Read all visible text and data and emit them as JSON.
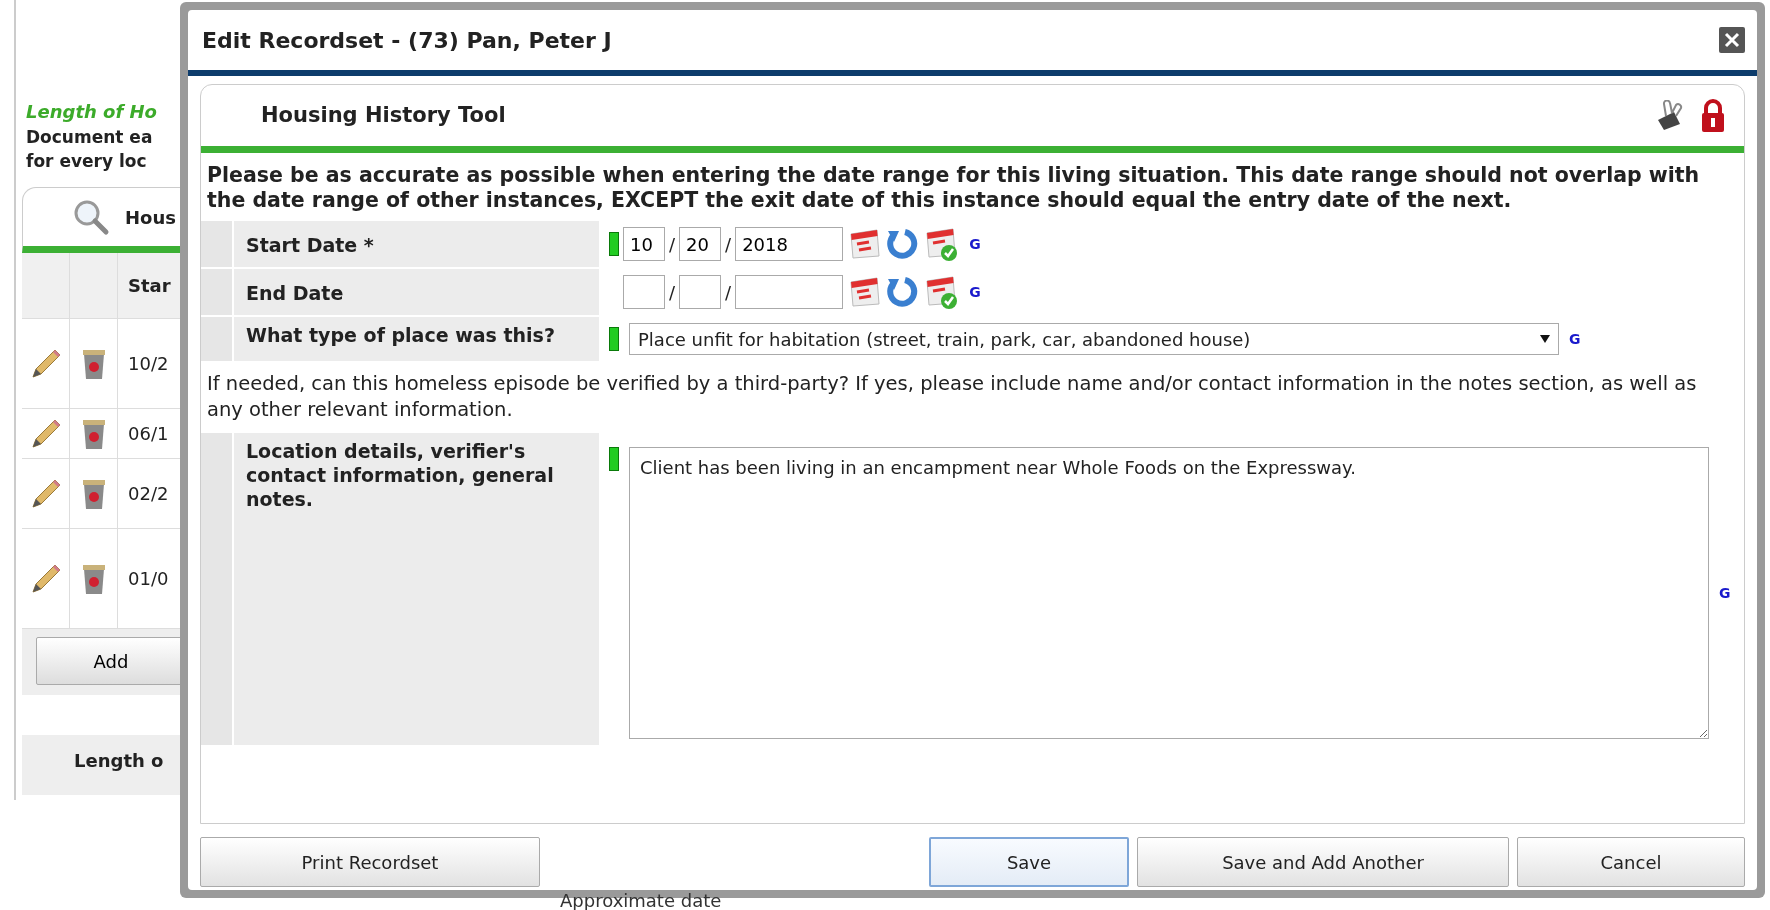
{
  "background": {
    "section_title": "Length of Ho",
    "instructions": [
      "Document ea",
      "for every loc"
    ],
    "tab": {
      "label": "Hous"
    },
    "table": {
      "columns": [
        "Star"
      ],
      "rows": [
        {
          "start": "10/2"
        },
        {
          "start": "06/1"
        },
        {
          "start": "02/2"
        },
        {
          "start": "01/0"
        }
      ]
    },
    "add_button": "Add",
    "lower_label": "Length o",
    "bottom_label": "Approximate date"
  },
  "dialog": {
    "title": "Edit Recordset - (73) Pan, Peter J",
    "panel_title": "Housing History Tool",
    "intro": "Please be as accurate as possible when entering the date range for this living situation. This date range should not overlap with the date range of other instances, EXCEPT the exit date of this instance should equal the entry date of the next.",
    "fields": [
      {
        "kind": "date",
        "label": "Start Date *",
        "flagged": true,
        "month": "10",
        "day": "20",
        "year": "2018",
        "separators": [
          "/",
          "/"
        ],
        "g": "G"
      },
      {
        "kind": "date",
        "label": "End Date",
        "flagged": false,
        "separators": [
          "/",
          "/"
        ],
        "g": "G"
      },
      {
        "kind": "select",
        "label": "What type of place was this?",
        "flagged": true,
        "value": "Place unfit for habitation (street, train, park, car, abandoned house)",
        "g": "G"
      },
      {
        "kind": "note",
        "text": "If needed, can this homeless episode be verified by a third-party? If yes, please include name and/or contact information in the notes section, as well as any other relevant information."
      },
      {
        "kind": "textarea",
        "label": "Location details, verifier's contact information, general notes.",
        "flagged": true,
        "value": "Client has been living in an encampment near Whole Foods on the Expressway.",
        "g": "G"
      }
    ],
    "buttons": [
      {
        "label": "Print Recordset",
        "focused": false
      },
      {
        "label": "Save",
        "focused": true
      },
      {
        "label": "Save and Add Another",
        "focused": false
      },
      {
        "label": "Cancel",
        "focused": false
      }
    ]
  }
}
